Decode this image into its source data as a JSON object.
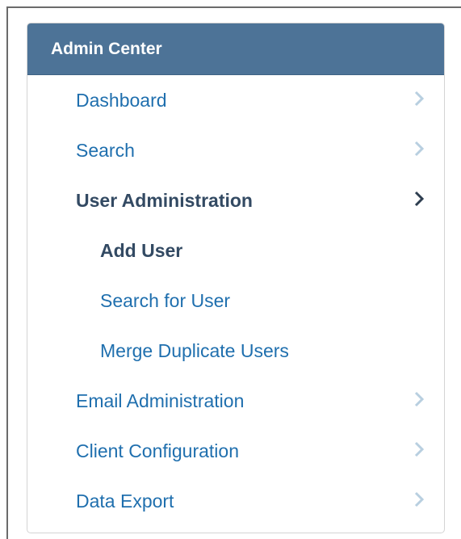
{
  "panel": {
    "title": "Admin Center",
    "items": [
      {
        "label": "Dashboard",
        "level": 0,
        "state": "link",
        "chevron": "light"
      },
      {
        "label": "Search",
        "level": 0,
        "state": "link",
        "chevron": "light"
      },
      {
        "label": "User Administration",
        "level": 0,
        "state": "expanded",
        "chevron": "dark"
      },
      {
        "label": "Add User",
        "level": 1,
        "state": "current",
        "chevron": "none"
      },
      {
        "label": "Search for User",
        "level": 1,
        "state": "link",
        "chevron": "none"
      },
      {
        "label": "Merge Duplicate Users",
        "level": 1,
        "state": "link",
        "chevron": "none"
      },
      {
        "label": "Email Administration",
        "level": 0,
        "state": "link",
        "chevron": "light"
      },
      {
        "label": "Client Configuration",
        "level": 0,
        "state": "link",
        "chevron": "light"
      },
      {
        "label": "Data Export",
        "level": 0,
        "state": "link",
        "chevron": "light"
      }
    ]
  },
  "colors": {
    "header_bg": "#4d7397",
    "link": "#1f6fae",
    "active_text": "#334a63",
    "chevron_light": "#b8cfe0",
    "chevron_dark": "#2e3e50"
  }
}
